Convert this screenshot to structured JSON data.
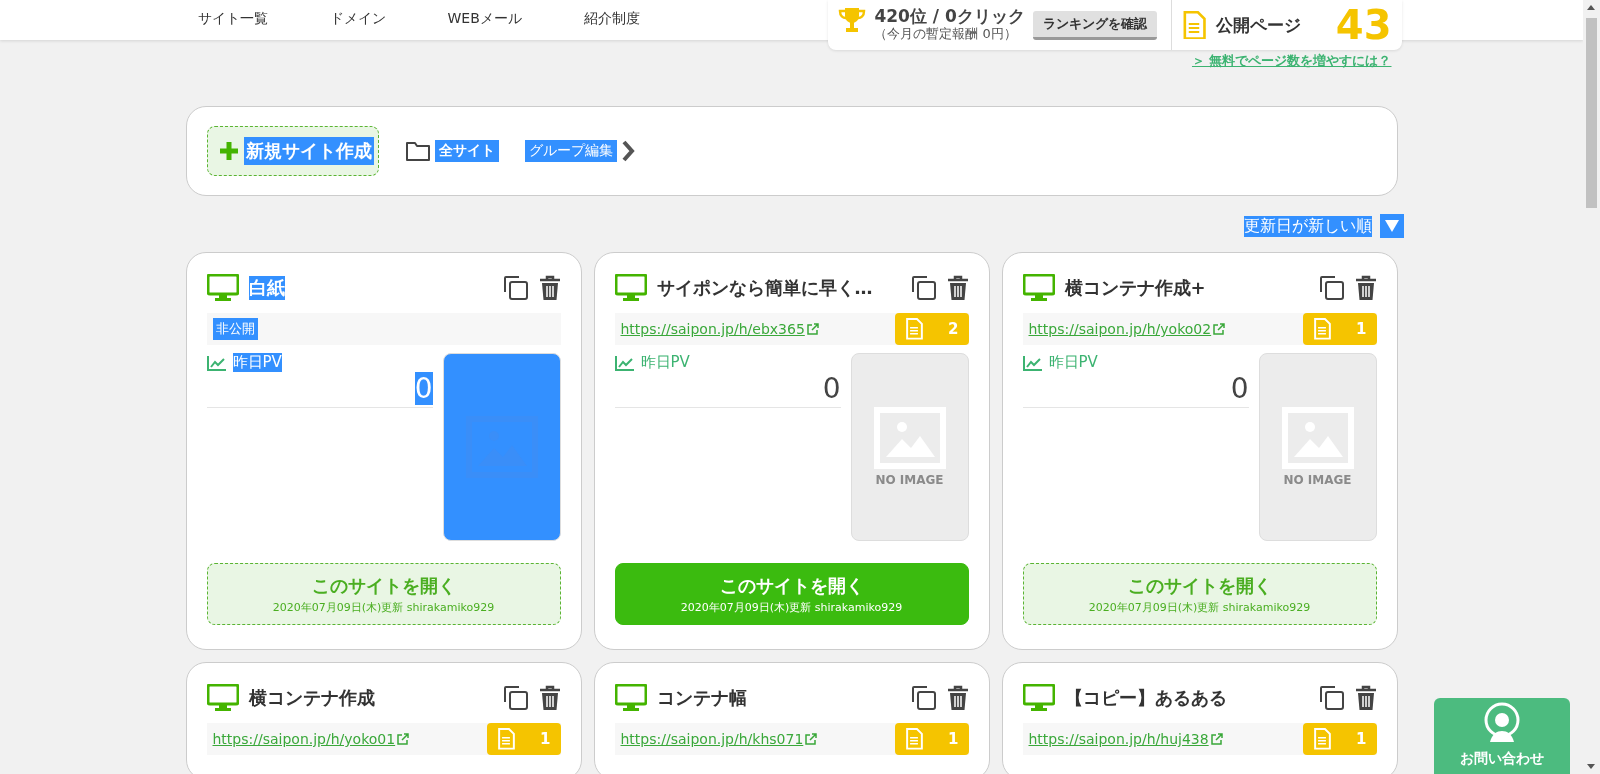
{
  "nav": [
    "サイト一覧",
    "ドメイン",
    "WEBメール",
    "紹介制度"
  ],
  "ranking": {
    "rank": "420位 / 0クリック",
    "reward": "（今月の暫定報酬 0円）",
    "button": "ランキングを確認"
  },
  "public_pages": {
    "label": "公開ページ",
    "count": "43"
  },
  "more_pages_link": "＞ 無料でページ数を増やすには？",
  "toolbar": {
    "new_site": {
      "label": "新規サイト作成",
      "highlighted": true
    },
    "all_sites": {
      "label": "全サイト",
      "highlighted": true
    },
    "group_edit": {
      "label": "グループ編集",
      "highlighted": true
    }
  },
  "sort": {
    "label": "更新日が新しい順",
    "highlighted": true
  },
  "cards": [
    {
      "kind": "private",
      "title": "白紙",
      "status": "非公開",
      "pv_label": "昨日PV",
      "pv": "0",
      "open": "このサイトを開く",
      "updated": "2020年07月09日(木)更新 shirakamiko929",
      "active": false,
      "highlighted": true
    },
    {
      "kind": "published",
      "title": "サイポンなら簡単に早く…",
      "url": "https://saipon.jp/h/ebx365",
      "pages": "2",
      "pv_label": "昨日PV",
      "pv": "0",
      "thumb_text": "NO IMAGE",
      "open": "このサイトを開く",
      "updated": "2020年07月09日(木)更新 shirakamiko929",
      "active": true,
      "highlighted": false
    },
    {
      "kind": "published",
      "title": "横コンテナ作成+",
      "url": "https://saipon.jp/h/yoko02",
      "pages": "1",
      "pv_label": "昨日PV",
      "pv": "0",
      "thumb_text": "NO IMAGE",
      "open": "このサイトを開く",
      "updated": "2020年07月09日(木)更新 shirakamiko929",
      "active": false,
      "highlighted": false
    },
    {
      "kind": "published",
      "title": "横コンテナ作成",
      "url": "https://saipon.jp/h/yoko01",
      "pages": "1",
      "highlighted": false
    },
    {
      "kind": "published",
      "title": "コンテナ幅",
      "url": "https://saipon.jp/h/khs071",
      "pages": "1",
      "highlighted": false
    },
    {
      "kind": "published",
      "title": "【コピー】あるある",
      "url": "https://saipon.jp/h/huj438",
      "pages": "1",
      "highlighted": false
    }
  ],
  "contact": "お問い合わせ"
}
